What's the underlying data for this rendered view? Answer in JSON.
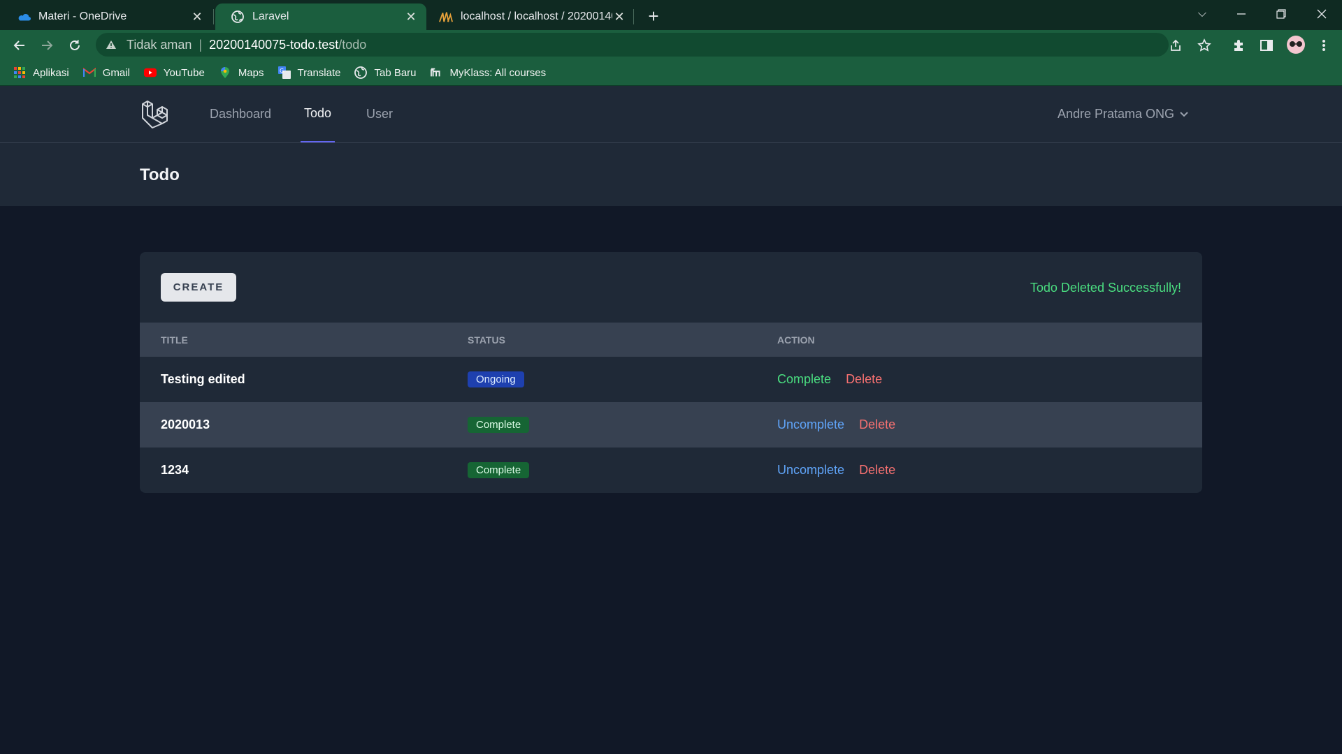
{
  "browser": {
    "tabs": [
      {
        "title": "Materi - OneDrive",
        "favicon": "onedrive-icon",
        "active": false
      },
      {
        "title": "Laravel",
        "favicon": "globe-icon",
        "active": true
      },
      {
        "title": "localhost / localhost / 20200140",
        "favicon": "phpmyadmin-icon",
        "active": false
      }
    ],
    "address": {
      "security_label": "Tidak aman",
      "host": "20200140075-todo.test",
      "path": "/todo"
    },
    "bookmarks": [
      {
        "label": "Aplikasi",
        "icon": "apps-grid-icon"
      },
      {
        "label": "Gmail",
        "icon": "gmail-icon"
      },
      {
        "label": "YouTube",
        "icon": "youtube-icon"
      },
      {
        "label": "Maps",
        "icon": "maps-icon"
      },
      {
        "label": "Translate",
        "icon": "translate-icon"
      },
      {
        "label": "Tab Baru",
        "icon": "globe-icon"
      },
      {
        "label": "MyKlass: All courses",
        "icon": "myklass-icon"
      }
    ]
  },
  "app": {
    "nav": [
      {
        "label": "Dashboard",
        "active": false
      },
      {
        "label": "Todo",
        "active": true
      },
      {
        "label": "User",
        "active": false
      }
    ],
    "user_name": "Andre Pratama ONG",
    "page_title": "Todo",
    "create_label": "CREATE",
    "flash_message": "Todo Deleted Successfully!",
    "table": {
      "headers": [
        "TITLE",
        "STATUS",
        "ACTION"
      ],
      "rows": [
        {
          "title": "Testing edited",
          "status": "Ongoing",
          "toggle": "Complete",
          "delete": "Delete"
        },
        {
          "title": "2020013",
          "status": "Complete",
          "toggle": "Uncomplete",
          "delete": "Delete"
        },
        {
          "title": "1234",
          "status": "Complete",
          "toggle": "Uncomplete",
          "delete": "Delete"
        }
      ]
    }
  },
  "colors": {
    "app_bg": "#111827",
    "panel_bg": "#1f2937",
    "accent": "#6366f1",
    "success": "#4ade80",
    "danger": "#f87171",
    "link_blue": "#60a5fa",
    "browser_frame": "#1b5e3e"
  }
}
